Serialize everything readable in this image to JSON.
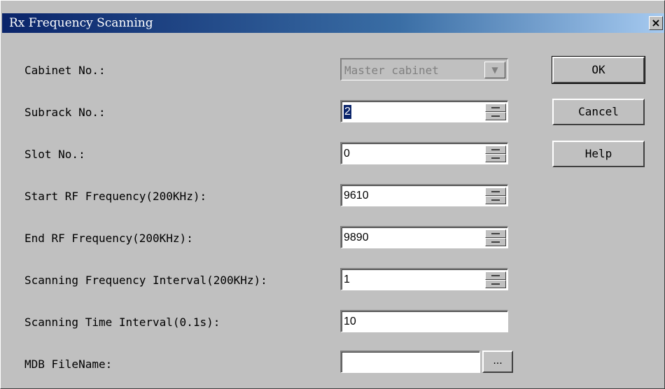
{
  "window": {
    "title": "Rx Frequency Scanning",
    "close_glyph": "×"
  },
  "form": {
    "cabinet": {
      "label": "Cabinet No.:",
      "value": "Master cabinet",
      "arrow": "▼"
    },
    "subrack": {
      "label": "Subrack No.:",
      "value": "2"
    },
    "slot": {
      "label": "Slot No.:",
      "value": "0"
    },
    "start_rf": {
      "label": "Start RF Frequency(200KHz):",
      "value": "9610"
    },
    "end_rf": {
      "label": "End RF Frequency(200KHz):",
      "value": "9890"
    },
    "scan_freq_interval": {
      "label": "Scanning Frequency Interval(200KHz):",
      "value": "1"
    },
    "scan_time_interval": {
      "label": "Scanning Time Interval(0.1s):",
      "value": "10"
    },
    "mdb_filename": {
      "label": "MDB FileName:",
      "value": "",
      "browse_label": "..."
    }
  },
  "buttons": {
    "ok": "OK",
    "cancel": "Cancel",
    "help": "Help"
  },
  "colors": {
    "dialog_bg": "#c0c0c0",
    "titlebar_start": "#0a246a",
    "titlebar_end": "#a6caf0",
    "selection": "#0a246a"
  }
}
